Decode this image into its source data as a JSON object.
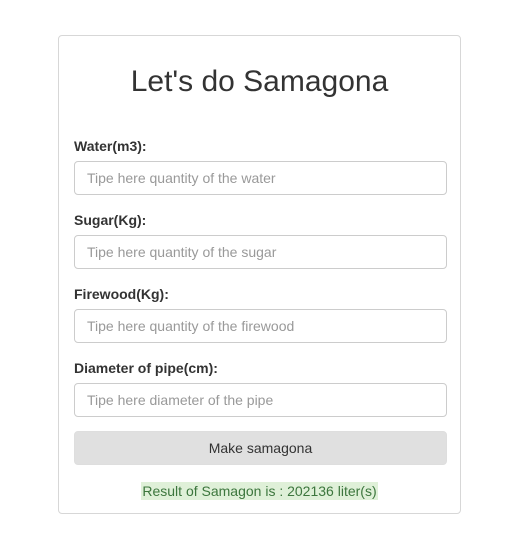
{
  "page": {
    "title": "Let's do Samagona"
  },
  "form": {
    "fields": [
      {
        "label": "Water(m3):",
        "placeholder": "Tipe here quantity of the water",
        "value": ""
      },
      {
        "label": "Sugar(Kg):",
        "placeholder": "Tipe here quantity of the sugar",
        "value": ""
      },
      {
        "label": "Firewood(Kg):",
        "placeholder": "Tipe here quantity of the firewood",
        "value": ""
      },
      {
        "label": "Diameter of pipe(cm):",
        "placeholder": "Tipe here diameter of the pipe",
        "value": ""
      }
    ],
    "submit_label": "Make samagona"
  },
  "result": {
    "text": "Result of Samagon is : 202136 liter(s)"
  },
  "colors": {
    "result_bg": "#dff0d8",
    "result_text": "#3c763d",
    "button_bg": "#e0e0e0"
  }
}
